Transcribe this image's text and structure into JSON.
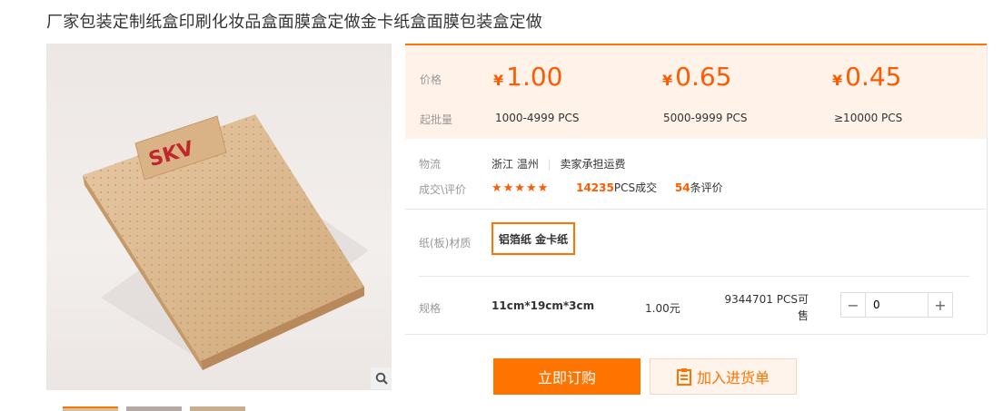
{
  "product": {
    "title": "厂家包装定制纸盒印刷化妆品盒面膜盒定做金卡纸盒面膜包装盒定做",
    "image_brand_text": "SKV"
  },
  "price_panel": {
    "price_label": "价格",
    "moq_label": "起批量",
    "tiers": [
      {
        "currency": "¥",
        "price": "1.00",
        "range": "1000-4999 PCS"
      },
      {
        "currency": "¥",
        "price": "0.65",
        "range": "5000-9999 PCS"
      },
      {
        "currency": "¥",
        "price": "0.45",
        "range": "≥10000 PCS"
      }
    ]
  },
  "logistics": {
    "label": "物流",
    "location": "浙江 温州",
    "shipping": "卖家承担运费"
  },
  "deals": {
    "label": "成交\\评价",
    "stars": "★★★★★",
    "deal_count": "14235",
    "deal_suffix": "PCS成交",
    "review_count": "54",
    "review_suffix": "条评价"
  },
  "material": {
    "label": "纸(板)材质",
    "selected": "铝箔纸 金卡纸"
  },
  "spec": {
    "label": "规格",
    "size": "11cm*19cm*3cm",
    "unit_price": "1.00元",
    "stock_line1": "9344701 PCS可",
    "stock_line2": "售",
    "quantity": "0",
    "minus": "−",
    "plus": "+"
  },
  "actions": {
    "buy_label": "立即订购",
    "cart_label": "加入进货单"
  },
  "colors": {
    "accent": "#ff7300",
    "price": "#ff5a00",
    "panel_bg": "#fff2e8"
  }
}
